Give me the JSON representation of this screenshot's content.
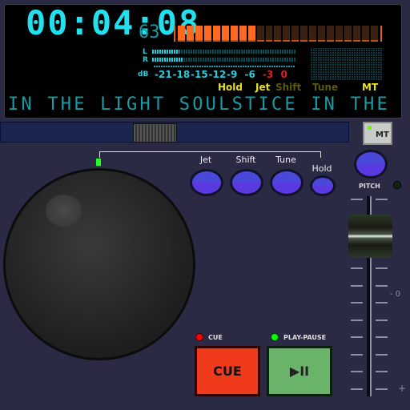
{
  "display": {
    "time": "00:04:08",
    "frames": "63",
    "level_segments_total": 23,
    "level_segments_lit": 9,
    "meter_labels": {
      "left": "L",
      "right": "R",
      "db": "dB"
    },
    "left_level": 0.19,
    "right_level": 0.21,
    "db_scale": [
      "-21",
      "-18",
      "-15",
      "-12",
      "-9",
      "-6",
      "-3",
      "0"
    ],
    "modes": [
      {
        "label": "Hold",
        "active": true
      },
      {
        "label": "Jet",
        "active": true
      },
      {
        "label": "Shift",
        "active": false
      },
      {
        "label": "Tune",
        "active": false
      },
      {
        "label": "MT",
        "active": true
      }
    ],
    "ticker": "IN THE LIGHT SOULSTICE IN THE"
  },
  "colors": {
    "cyan": "#22e0ee",
    "orange": "#ff6a20",
    "yellow": "#e8e020",
    "dim_yellow": "#5a5a10",
    "red": "#e02020"
  },
  "mt_button": "MT",
  "effects": [
    {
      "label": "Jet"
    },
    {
      "label": "Shift"
    },
    {
      "label": "Tune"
    },
    {
      "label": "Hold"
    }
  ],
  "pitch": {
    "label": "PITCH",
    "zero_label": "- 0",
    "plus_label": "+",
    "value_fraction": 0.2
  },
  "cue": {
    "indicator": "CUE",
    "label": "CUE"
  },
  "play": {
    "indicator": "PLAY-PAUSE",
    "icon": "play-pause-icon",
    "glyph": "▶II"
  }
}
